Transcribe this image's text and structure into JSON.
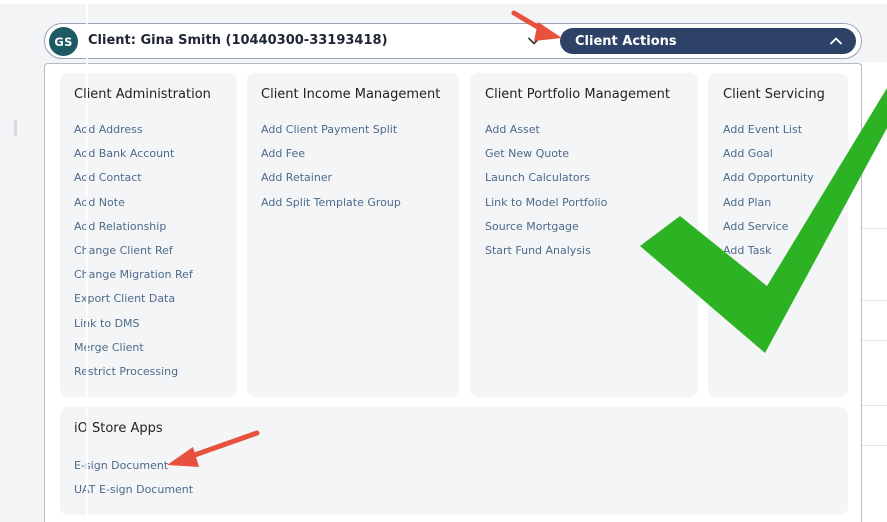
{
  "header": {
    "avatar_initials": "GS",
    "client_label": "Client: Gina Smith (10440300-33193418)",
    "actions_label": "Client Actions"
  },
  "menu": {
    "client_administration": {
      "title": "Client Administration",
      "items": [
        "Add Address",
        "Add Bank Account",
        "Add Contact",
        "Add Note",
        "Add Relationship",
        "Change Client Ref",
        "Change Migration Ref",
        "Export Client Data",
        "Link to DMS",
        "Merge Client",
        "Restrict Processing"
      ]
    },
    "client_income_management": {
      "title": "Client Income Management",
      "items": [
        "Add Client Payment Split",
        "Add Fee",
        "Add Retainer",
        "Add Split Template Group"
      ]
    },
    "client_portfolio_management": {
      "title": "Client Portfolio Management",
      "items": [
        "Add Asset",
        "Get New Quote",
        "Launch Calculators",
        "Link to Model Portfolio",
        "Source Mortgage",
        "Start Fund Analysis"
      ]
    },
    "client_servicing": {
      "title": "Client Servicing",
      "items": [
        "Add Event List",
        "Add Goal",
        "Add Opportunity",
        "Add Plan",
        "Add Service",
        "Add Task"
      ]
    },
    "store_apps": {
      "title": "iO Store Apps",
      "items": [
        "E-sign Document",
        "UAT E-sign Document"
      ]
    }
  },
  "colors": {
    "actions_bg": "#2e4166",
    "avatar_bg": "#1d5a63",
    "link": "#4d6a8a",
    "annotation_arrow": "#e8513d",
    "annotation_check": "#2db224"
  }
}
